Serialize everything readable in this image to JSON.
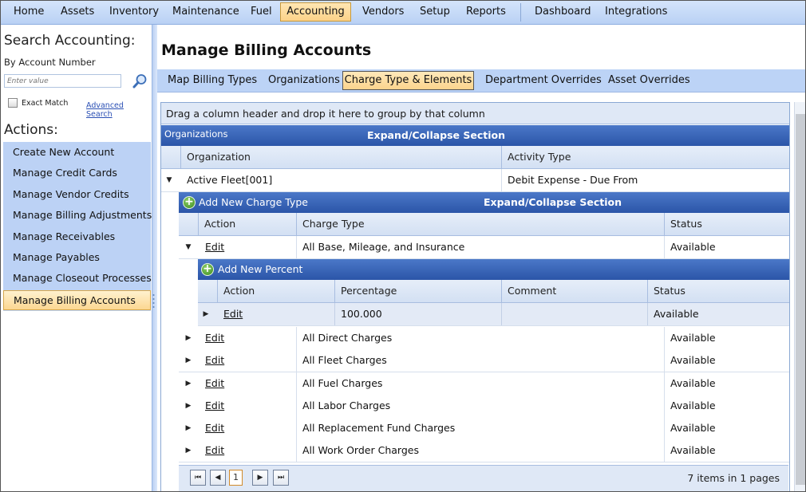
{
  "nav": {
    "items": [
      {
        "label": "Home"
      },
      {
        "label": "Assets"
      },
      {
        "label": "Inventory"
      },
      {
        "label": "Maintenance"
      },
      {
        "label": "Fuel"
      },
      {
        "label": "Accounting"
      },
      {
        "label": "Vendors"
      },
      {
        "label": "Setup"
      },
      {
        "label": "Reports"
      },
      {
        "label": "Dashboard"
      },
      {
        "label": "Integrations"
      }
    ],
    "active": "Accounting"
  },
  "sidebar": {
    "search_title": "Search Accounting:",
    "search_subtitle": "By Account Number",
    "search_placeholder": "Enter value",
    "exact_match_label": "Exact Match",
    "advanced_search_label": "Advanced Search",
    "actions_title": "Actions:",
    "actions": [
      {
        "label": "Create New Account"
      },
      {
        "label": "Manage Credit Cards"
      },
      {
        "label": "Manage Vendor Credits"
      },
      {
        "label": "Manage Billing Adjustments"
      },
      {
        "label": "Manage Receivables"
      },
      {
        "label": "Manage Payables"
      },
      {
        "label": "Manage Closeout Processes"
      },
      {
        "label": "Manage Billing Accounts"
      }
    ],
    "active_action": "Manage Billing Accounts"
  },
  "page": {
    "title": "Manage Billing Accounts",
    "tabs": [
      {
        "label": "Map Billing Types"
      },
      {
        "label": "Organizations"
      },
      {
        "label": "Charge Type & Elements"
      },
      {
        "label": "Department Overrides"
      },
      {
        "label": "Asset Overrides"
      }
    ],
    "active_tab": "Charge Type & Elements"
  },
  "grid": {
    "group_panel_text": "Drag a column header and drop it here to group by that column",
    "section_left": "Organizations",
    "expand_collapse_label": "Expand/Collapse Section",
    "org_columns": {
      "organization": "Organization",
      "activity_type": "Activity Type"
    },
    "org_row": {
      "organization": "Active Fleet[001]",
      "activity_type": "Debit Expense - Due From"
    },
    "charge_section": {
      "add_label": "Add New Charge Type",
      "expand_collapse_label": "Expand/Collapse Section"
    },
    "charge_columns": {
      "action": "Action",
      "charge_type": "Charge Type",
      "status": "Status"
    },
    "charge_rows": [
      {
        "action": "Edit",
        "charge_type": "All Base, Mileage, and Insurance",
        "status": "Available"
      },
      {
        "action": "Edit",
        "charge_type": "All Direct Charges",
        "status": "Available"
      },
      {
        "action": "Edit",
        "charge_type": "All Fleet Charges",
        "status": "Available"
      },
      {
        "action": "Edit",
        "charge_type": "All Fuel Charges",
        "status": "Available"
      },
      {
        "action": "Edit",
        "charge_type": "All Labor Charges",
        "status": "Available"
      },
      {
        "action": "Edit",
        "charge_type": "All Replacement Fund Charges",
        "status": "Available"
      },
      {
        "action": "Edit",
        "charge_type": "All Work Order Charges",
        "status": "Available"
      }
    ],
    "percent_section": {
      "add_label": "Add New Percent"
    },
    "percent_columns": {
      "action": "Action",
      "percentage": "Percentage",
      "comment": "Comment",
      "status": "Status"
    },
    "percent_row": {
      "action": "Edit",
      "percentage": "100.000",
      "comment": "",
      "status": "Available"
    },
    "pager": {
      "current_page": "1",
      "info": "7 items in 1 pages"
    }
  }
}
